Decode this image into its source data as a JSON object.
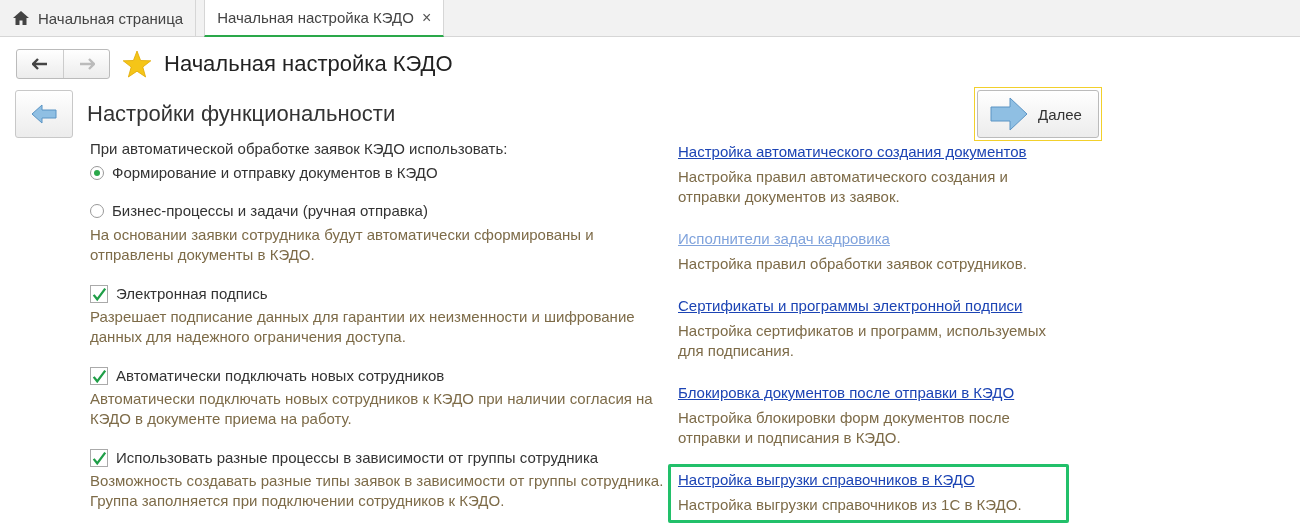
{
  "tabs": [
    {
      "label": "Начальная страница",
      "kind": "home",
      "selected": false
    },
    {
      "label": "Начальная настройка КЭДО",
      "kind": "page",
      "selected": true,
      "close": "×"
    }
  ],
  "header": {
    "title": "Начальная настройка КЭДО",
    "back_disabled": false,
    "forward_disabled": true
  },
  "step": {
    "title": "Настройки функциональности",
    "next_button": "Далее"
  },
  "options": {
    "prompt": "При автоматической обработке заявок КЭДО использовать:",
    "radios": [
      {
        "label": "Формирование и отправку документов в КЭДО",
        "selected": true
      },
      {
        "label": "Бизнес-процессы и задачи (ручная отправка)",
        "selected": false,
        "description": "На основании заявки сотрудника будут автоматически сформированы и отправлены документы в КЭДО."
      }
    ],
    "checkboxes": [
      {
        "label": "Электронная подпись",
        "checked": true,
        "description": "Разрешает подписание данных для гарантии их неизменности и шифрование данных для надежного ограничения доступа."
      },
      {
        "label": "Автоматически подключать новых сотрудников",
        "checked": true,
        "description": "Автоматически подключать новых сотрудников к КЭДО при наличии согласия на КЭДО в документе приема на работу."
      },
      {
        "label": "Использовать разные процессы в зависимости от группы сотрудника",
        "checked": true,
        "description": "Возможность создавать разные типы заявок в зависимости от группы сотрудника. Группа заполняется при подключении сотрудников к КЭДО."
      }
    ]
  },
  "links": [
    {
      "label": "Настройка автоматического создания документов",
      "disabled": false,
      "highlighted": false,
      "description": "Настройка правил автоматического создания и отправки документов из заявок."
    },
    {
      "label": "Исполнители задач кадровика",
      "disabled": true,
      "highlighted": false,
      "description": "Настройка правил обработки заявок сотрудников."
    },
    {
      "label": "Сертификаты и программы электронной подписи",
      "disabled": false,
      "highlighted": false,
      "description": "Настройка сертификатов и программ, используемых для подписания."
    },
    {
      "label": "Блокировка документов после отправки в КЭДО",
      "disabled": false,
      "highlighted": false,
      "description": "Настройка блокировки форм документов после отправки и подписания в КЭДО."
    },
    {
      "label": "Настройка выгрузки справочников в КЭДО",
      "disabled": false,
      "highlighted": true,
      "description": "Настройка выгрузки справочников из 1С в КЭДО."
    }
  ]
}
